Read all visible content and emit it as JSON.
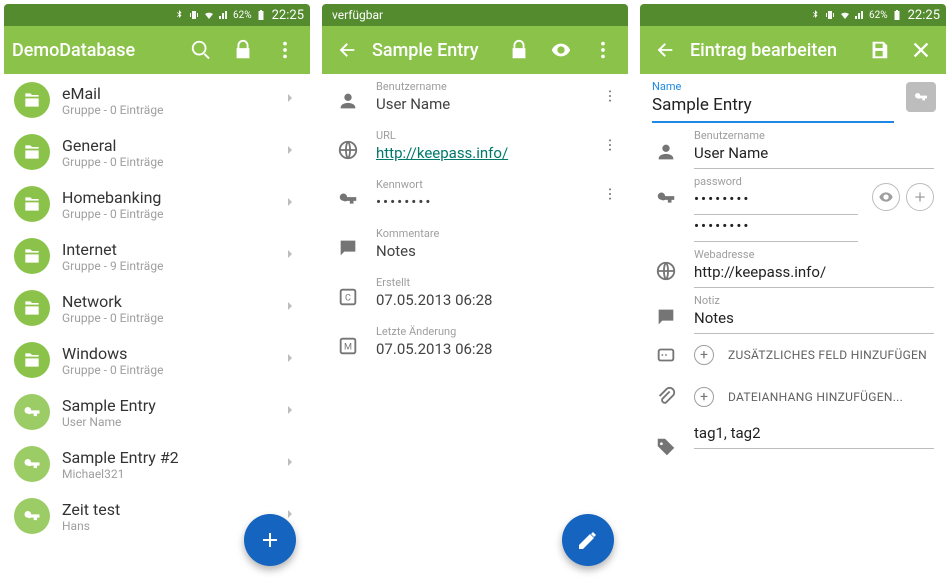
{
  "status": {
    "time": "22:25",
    "battery": "62%",
    "available_text": "verfügbar"
  },
  "screen1": {
    "title": "DemoDatabase",
    "items": [
      {
        "title": "eMail",
        "sub": "Gruppe - 0 Einträge",
        "type": "folder"
      },
      {
        "title": "General",
        "sub": "Gruppe - 0 Einträge",
        "type": "folder"
      },
      {
        "title": "Homebanking",
        "sub": "Gruppe - 0 Einträge",
        "type": "folder"
      },
      {
        "title": "Internet",
        "sub": "Gruppe - 9 Einträge",
        "type": "folder"
      },
      {
        "title": "Network",
        "sub": "Gruppe - 0 Einträge",
        "type": "folder"
      },
      {
        "title": "Windows",
        "sub": "Gruppe - 0 Einträge",
        "type": "folder"
      },
      {
        "title": "Sample Entry",
        "sub": "User Name",
        "type": "key"
      },
      {
        "title": "Sample Entry #2",
        "sub": "Michael321",
        "type": "key"
      },
      {
        "title": "Zeit test",
        "sub": "Hans",
        "type": "key"
      }
    ]
  },
  "screen2": {
    "title": "Sample Entry",
    "fields": {
      "user_label": "Benutzername",
      "user_value": "User Name",
      "url_label": "URL",
      "url_value": "http://keepass.info/",
      "pass_label": "Kennwort",
      "pass_value": "••••••••",
      "comment_label": "Kommentare",
      "comment_value": "Notes",
      "created_label": "Erstellt",
      "created_value": "07.05.2013 06:28",
      "modified_label": "Letzte Änderung",
      "modified_value": "07.05.2013 06:28"
    }
  },
  "screen3": {
    "title": "Eintrag bearbeiten",
    "name_label": "Name",
    "name_value": "Sample Entry",
    "user_label": "Benutzername",
    "user_value": "User Name",
    "pass_label": "password",
    "pass_value": "••••••••",
    "pass_value2": "••••••••",
    "url_label": "Webadresse",
    "url_value": "http://keepass.info/",
    "note_label": "Notiz",
    "note_value": "Notes",
    "add_field": "ZUSÄTZLICHES FELD HINZUFÜGEN",
    "add_file": "DATEIANHANG HINZUFÜGEN...",
    "tags": "tag1, tag2"
  }
}
